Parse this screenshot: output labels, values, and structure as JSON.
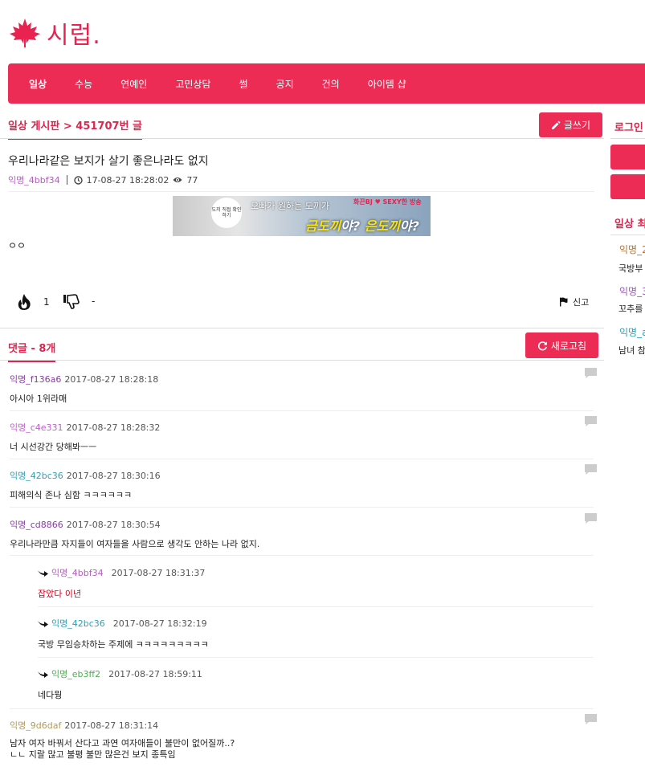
{
  "site": {
    "logo_text": "시럽."
  },
  "nav": {
    "items": [
      "일상",
      "수능",
      "연예인",
      "고민상담",
      "썰",
      "공지",
      "건의",
      "아이템 샵"
    ]
  },
  "board": {
    "title": "일상 게시판 > 451707번 글",
    "write_label": "글쓰기"
  },
  "post": {
    "title": "우리나라같은 보지가 살기 좋은나라도 없지",
    "author": "익명_4bbf34",
    "datetime": "17-08-27 18:28:02",
    "views": "77",
    "body": "ㅇㅇ",
    "likes": "1",
    "dislikes": "-",
    "report_label": "신고"
  },
  "ad": {
    "circle_text": "도끼 직접 확인하기",
    "top_text": "오빠가 원하는 도끼가",
    "top_text2": "화끈BJ ♥ SEXY한 방송",
    "main_a": "금도끼",
    "main_b": "야? ",
    "main_c": "은도끼",
    "main_d": "야?"
  },
  "comments_section": {
    "title": "댓글 - 8개",
    "refresh_label": "새로고침"
  },
  "comments": [
    {
      "author": "익명_f136a6",
      "datetime": "2017-08-27 18:28:18",
      "body": "아시아 1위라매",
      "color": "#8b3aa8"
    },
    {
      "author": "익명_c4e331",
      "datetime": "2017-08-27 18:28:32",
      "body": "너 시선강간 당해봐ㅡㅡ",
      "color": "#c05ecf"
    },
    {
      "author": "익명_42bc36",
      "datetime": "2017-08-27 18:30:16",
      "body": "피해의식 존나 심함 ㅋㅋㅋㅋㅋㅋ",
      "color": "#2aa3b8"
    },
    {
      "author": "익명_cd8866",
      "datetime": "2017-08-27 18:30:54",
      "body": "우리나라만큼 자지들이 여자들을 사람으로 생각도 안하는 나라 없지.",
      "color": "#8b3aa8"
    }
  ],
  "replies": [
    {
      "author": "익명_4bbf34",
      "datetime": "2017-08-27 18:31:37",
      "body": "잡았다 이년",
      "color": "#b55dc0",
      "body_color": "#d0021b"
    },
    {
      "author": "익명_42bc36",
      "datetime": "2017-08-27 18:32:19",
      "body": "국방 무임승차하는 주제에 ㅋㅋㅋㅋㅋㅋㅋㅋㅋ",
      "color": "#2aa3b8",
      "body_color": "#222222"
    },
    {
      "author": "익명_eb3ff2",
      "datetime": "2017-08-27 18:59:11",
      "body": "네다뭥",
      "color": "#4caf50",
      "body_color": "#222222"
    }
  ],
  "last_comment": {
    "author": "익명_9d6daf",
    "datetime": "2017-08-27 18:31:14",
    "body_line1": "남자 여자 바꿔서 산다고 과연 여자애들이 불만이 없어질까..?",
    "body_line2": "ㄴㄴ 지랄 많고 불평 불만 많은건 보지 종특임",
    "color": "#b59a5a"
  },
  "sidebar": {
    "login_title": "로그인",
    "hot_title": "일상 최",
    "items": [
      {
        "author": "익명_2",
        "text": "국방부",
        "color": "#b5763a"
      },
      {
        "author": "익명_3",
        "text": "꼬추를",
        "color": "#9b59b6"
      },
      {
        "author": "익명_a",
        "text": "남녀 참",
        "color": "#2aa3b8"
      }
    ]
  }
}
